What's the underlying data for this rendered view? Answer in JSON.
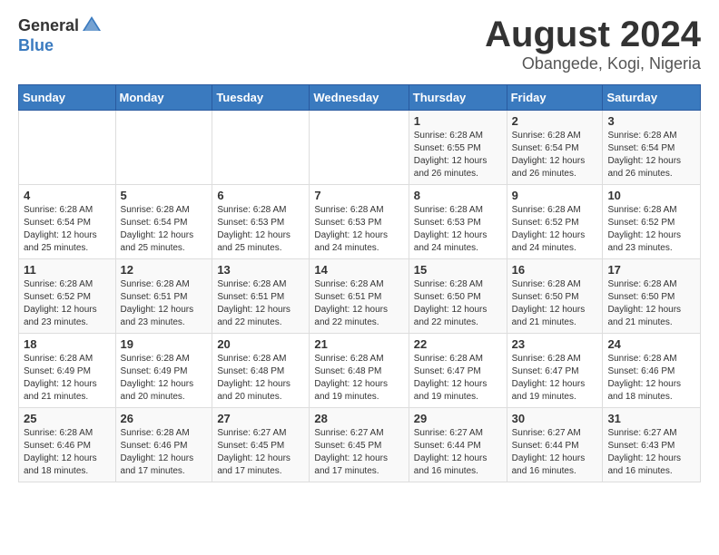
{
  "header": {
    "logo_general": "General",
    "logo_blue": "Blue",
    "month_title": "August 2024",
    "location": "Obangede, Kogi, Nigeria"
  },
  "days_of_week": [
    "Sunday",
    "Monday",
    "Tuesday",
    "Wednesday",
    "Thursday",
    "Friday",
    "Saturday"
  ],
  "weeks": [
    [
      {
        "day": "",
        "info": ""
      },
      {
        "day": "",
        "info": ""
      },
      {
        "day": "",
        "info": ""
      },
      {
        "day": "",
        "info": ""
      },
      {
        "day": "1",
        "info": "Sunrise: 6:28 AM\nSunset: 6:55 PM\nDaylight: 12 hours\nand 26 minutes."
      },
      {
        "day": "2",
        "info": "Sunrise: 6:28 AM\nSunset: 6:54 PM\nDaylight: 12 hours\nand 26 minutes."
      },
      {
        "day": "3",
        "info": "Sunrise: 6:28 AM\nSunset: 6:54 PM\nDaylight: 12 hours\nand 26 minutes."
      }
    ],
    [
      {
        "day": "4",
        "info": "Sunrise: 6:28 AM\nSunset: 6:54 PM\nDaylight: 12 hours\nand 25 minutes."
      },
      {
        "day": "5",
        "info": "Sunrise: 6:28 AM\nSunset: 6:54 PM\nDaylight: 12 hours\nand 25 minutes."
      },
      {
        "day": "6",
        "info": "Sunrise: 6:28 AM\nSunset: 6:53 PM\nDaylight: 12 hours\nand 25 minutes."
      },
      {
        "day": "7",
        "info": "Sunrise: 6:28 AM\nSunset: 6:53 PM\nDaylight: 12 hours\nand 24 minutes."
      },
      {
        "day": "8",
        "info": "Sunrise: 6:28 AM\nSunset: 6:53 PM\nDaylight: 12 hours\nand 24 minutes."
      },
      {
        "day": "9",
        "info": "Sunrise: 6:28 AM\nSunset: 6:52 PM\nDaylight: 12 hours\nand 24 minutes."
      },
      {
        "day": "10",
        "info": "Sunrise: 6:28 AM\nSunset: 6:52 PM\nDaylight: 12 hours\nand 23 minutes."
      }
    ],
    [
      {
        "day": "11",
        "info": "Sunrise: 6:28 AM\nSunset: 6:52 PM\nDaylight: 12 hours\nand 23 minutes."
      },
      {
        "day": "12",
        "info": "Sunrise: 6:28 AM\nSunset: 6:51 PM\nDaylight: 12 hours\nand 23 minutes."
      },
      {
        "day": "13",
        "info": "Sunrise: 6:28 AM\nSunset: 6:51 PM\nDaylight: 12 hours\nand 22 minutes."
      },
      {
        "day": "14",
        "info": "Sunrise: 6:28 AM\nSunset: 6:51 PM\nDaylight: 12 hours\nand 22 minutes."
      },
      {
        "day": "15",
        "info": "Sunrise: 6:28 AM\nSunset: 6:50 PM\nDaylight: 12 hours\nand 22 minutes."
      },
      {
        "day": "16",
        "info": "Sunrise: 6:28 AM\nSunset: 6:50 PM\nDaylight: 12 hours\nand 21 minutes."
      },
      {
        "day": "17",
        "info": "Sunrise: 6:28 AM\nSunset: 6:50 PM\nDaylight: 12 hours\nand 21 minutes."
      }
    ],
    [
      {
        "day": "18",
        "info": "Sunrise: 6:28 AM\nSunset: 6:49 PM\nDaylight: 12 hours\nand 21 minutes."
      },
      {
        "day": "19",
        "info": "Sunrise: 6:28 AM\nSunset: 6:49 PM\nDaylight: 12 hours\nand 20 minutes."
      },
      {
        "day": "20",
        "info": "Sunrise: 6:28 AM\nSunset: 6:48 PM\nDaylight: 12 hours\nand 20 minutes."
      },
      {
        "day": "21",
        "info": "Sunrise: 6:28 AM\nSunset: 6:48 PM\nDaylight: 12 hours\nand 19 minutes."
      },
      {
        "day": "22",
        "info": "Sunrise: 6:28 AM\nSunset: 6:47 PM\nDaylight: 12 hours\nand 19 minutes."
      },
      {
        "day": "23",
        "info": "Sunrise: 6:28 AM\nSunset: 6:47 PM\nDaylight: 12 hours\nand 19 minutes."
      },
      {
        "day": "24",
        "info": "Sunrise: 6:28 AM\nSunset: 6:46 PM\nDaylight: 12 hours\nand 18 minutes."
      }
    ],
    [
      {
        "day": "25",
        "info": "Sunrise: 6:28 AM\nSunset: 6:46 PM\nDaylight: 12 hours\nand 18 minutes."
      },
      {
        "day": "26",
        "info": "Sunrise: 6:28 AM\nSunset: 6:46 PM\nDaylight: 12 hours\nand 17 minutes."
      },
      {
        "day": "27",
        "info": "Sunrise: 6:27 AM\nSunset: 6:45 PM\nDaylight: 12 hours\nand 17 minutes."
      },
      {
        "day": "28",
        "info": "Sunrise: 6:27 AM\nSunset: 6:45 PM\nDaylight: 12 hours\nand 17 minutes."
      },
      {
        "day": "29",
        "info": "Sunrise: 6:27 AM\nSunset: 6:44 PM\nDaylight: 12 hours\nand 16 minutes."
      },
      {
        "day": "30",
        "info": "Sunrise: 6:27 AM\nSunset: 6:44 PM\nDaylight: 12 hours\nand 16 minutes."
      },
      {
        "day": "31",
        "info": "Sunrise: 6:27 AM\nSunset: 6:43 PM\nDaylight: 12 hours\nand 16 minutes."
      }
    ]
  ]
}
